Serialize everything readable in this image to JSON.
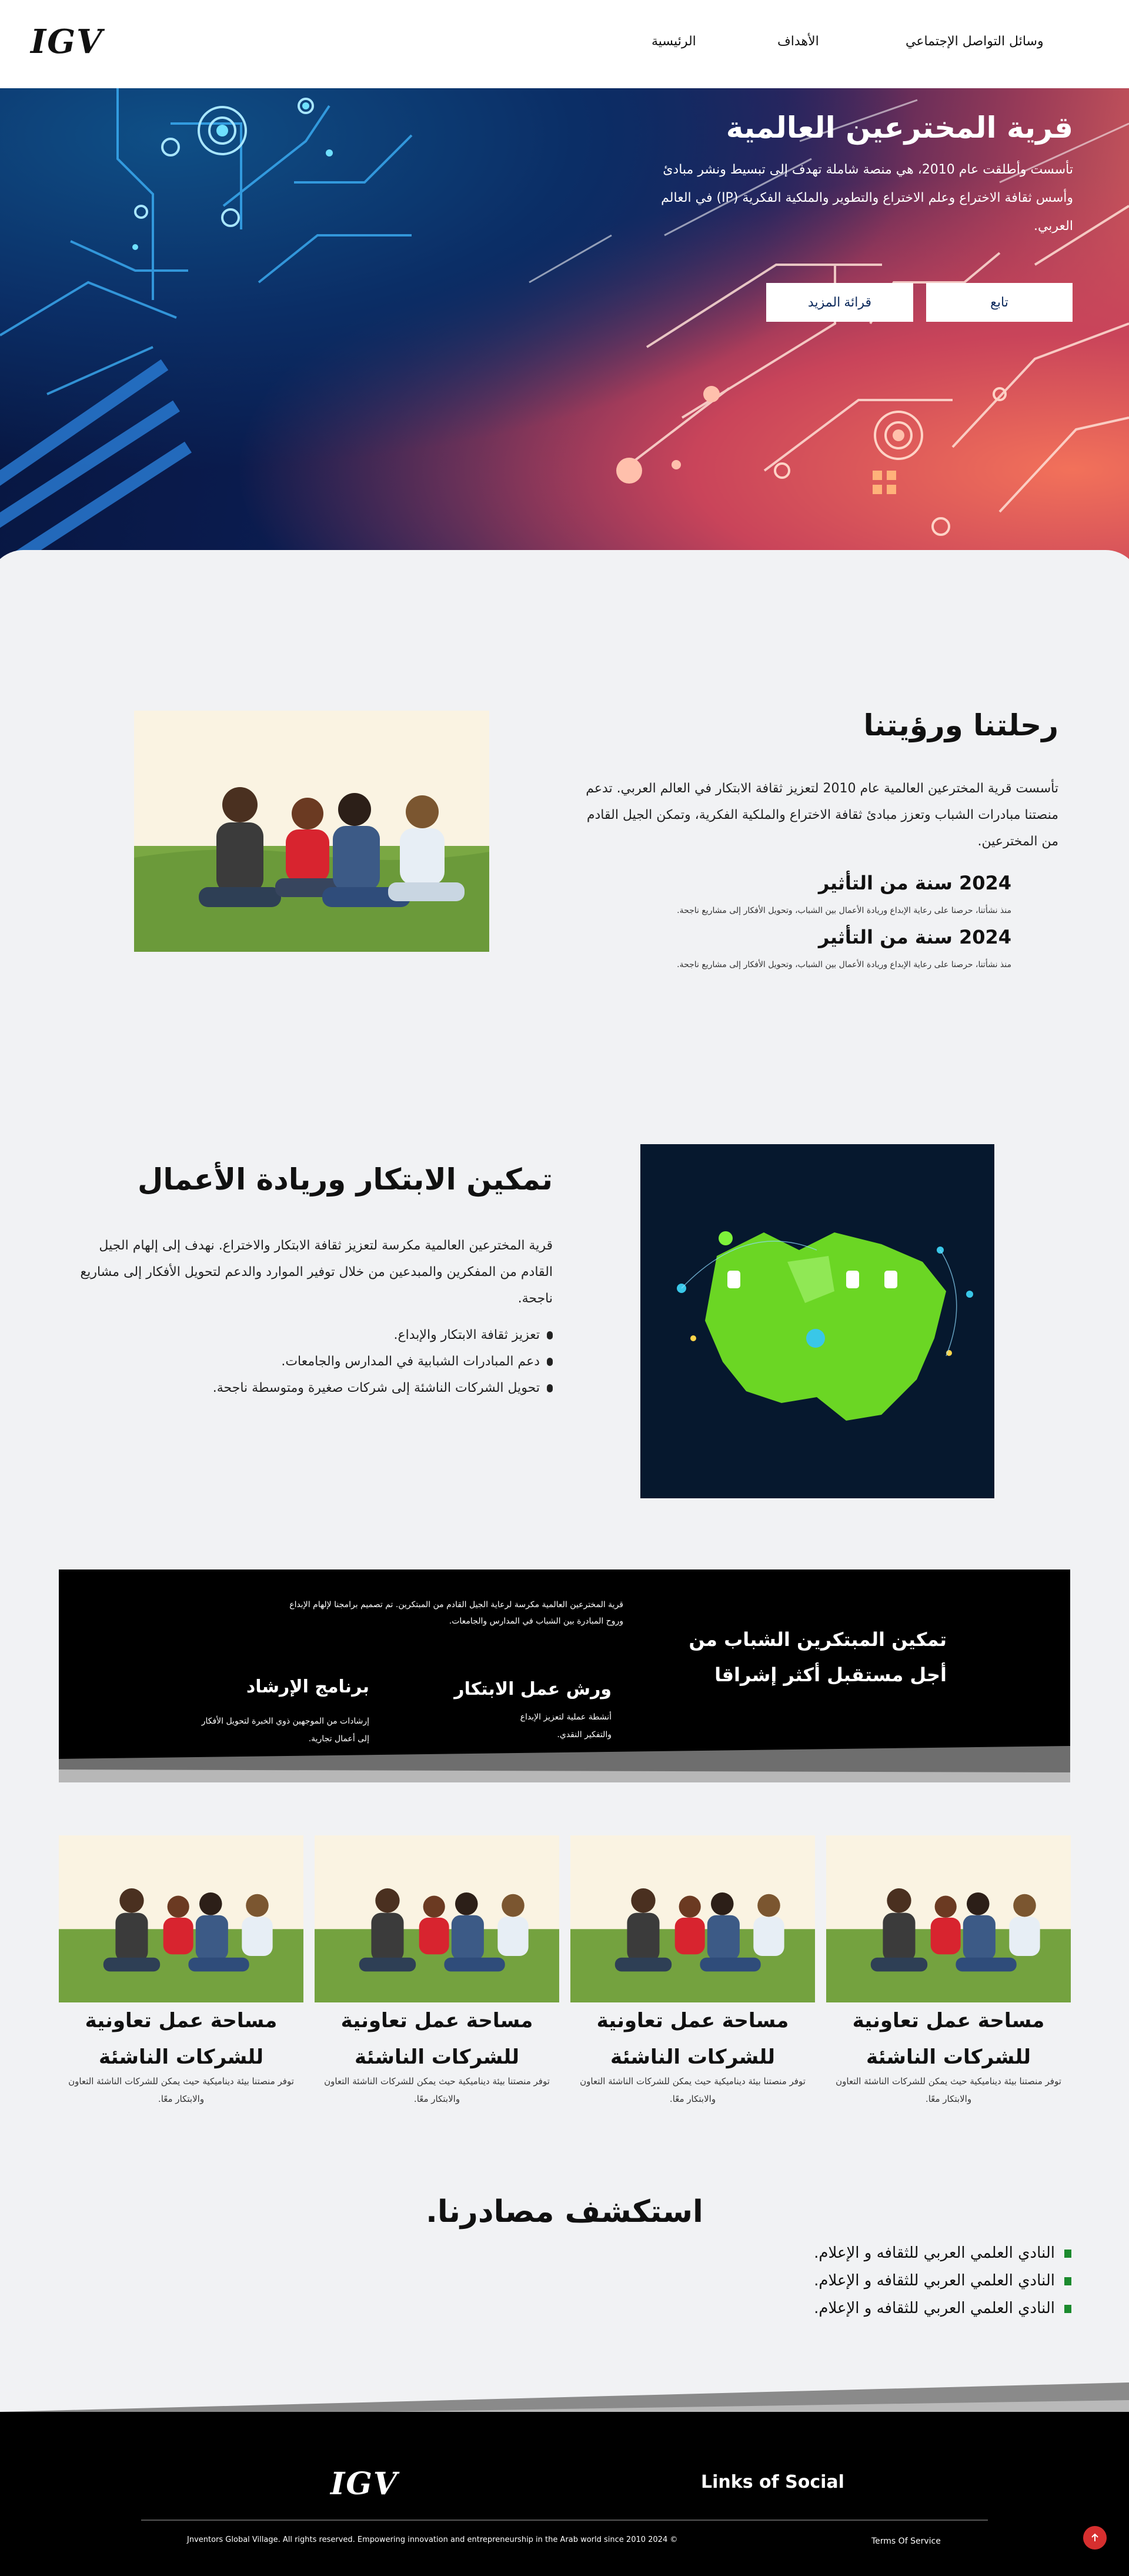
{
  "header": {
    "logo": "IGV",
    "nav": {
      "home": "الرئيسية",
      "goals": "الأهداف",
      "social": "وسائل التواصل الإجتماعي"
    }
  },
  "hero": {
    "title": "قرية المخترعين العالمية",
    "text": "تأسست وأطلقت عام 2010، هي منصة شاملة تهدف إلى تبسيط ونشر مبادئ وأسس ثقافة الاختراع وعلم الاختراع والتطوير والملكية الفكرية (IP) في العالم العربي.",
    "follow_label": "تابع",
    "read_more_label": "قرائة المزيد"
  },
  "journey": {
    "title": "رحلتنا ورؤيتنا",
    "text": "تأسست قرية المخترعين العالمية عام 2010 لتعزيز ثقافة الابتكار في العالم العربي. تدعم منصتنا مبادرات الشباب وتعزز مبادئ ثقافة الاختراع والملكية الفكرية، وتمكن الجيل القادم من المخترعين.",
    "stats": [
      {
        "title": "2024 سنة من التأثير",
        "desc": "منذ نشأتنا، حرصنا على رعاية الإبداع وريادة الأعمال بين الشباب، وتحويل الأفكار إلى مشاريع ناجحة."
      },
      {
        "title": "2024 سنة من التأثير",
        "desc": "منذ نشأتنا، حرصنا على رعاية الإبداع وريادة الأعمال بين الشباب، وتحويل الأفكار إلى مشاريع ناجحة."
      }
    ]
  },
  "empower": {
    "title": "تمكين الابتكار وريادة الأعمال",
    "text": "قرية المخترعين العالمية مكرسة لتعزيز ثقافة الابتكار والاختراع. نهدف إلى إلهام الجيل القادم من المفكرين والمبدعين من خلال توفير الموارد والدعم لتحويل الأفكار إلى مشاريع ناجحة.",
    "bullets": [
      "تعزيز ثقافة الابتكار والإبداع.",
      "دعم المبادرات الشبابية في المدارس والجامعات.",
      "تحويل الشركات الناشئة إلى شركات صغيرة ومتوسطة ناجحة."
    ]
  },
  "band": {
    "headline_line1": "تمكين المبتكرين الشباب من",
    "headline_line2": "أجل مستقبل أكثر إشراقا",
    "intro_line1": "قرية المخترعين العالمية مكرسة لرعاية الجيل القادم من المبتكرين. تم تصميم برامجنا لإلهام الإبداع",
    "intro_line2": "وروح المبادرة بين الشباب في المدارس والجامعات.",
    "workshops": {
      "title": "ورش عمل الابتكار",
      "line1": "أنشطة عملية لتعزيز الإبداع",
      "line2": "والتفكير النقدي."
    },
    "mentor": {
      "title": "برنامج الإرشاد",
      "line1": "إرشادات من الموجهين ذوي الخبرة لتحويل الأفكار",
      "line2": "إلى أعمال تجارية."
    }
  },
  "cards": [
    {
      "title": "مساحة عمل تعاونية للشركات الناشئة",
      "desc": "توفر منصتنا بيئة ديناميكية حيث يمكن للشركات الناشئة التعاون والابتكار معًا."
    },
    {
      "title": "مساحة عمل تعاونية للشركات الناشئة",
      "desc": "توفر منصتنا بيئة ديناميكية حيث يمكن للشركات الناشئة التعاون والابتكار معًا."
    },
    {
      "title": "مساحة عمل تعاونية للشركات الناشئة",
      "desc": "توفر منصتنا بيئة ديناميكية حيث يمكن للشركات الناشئة التعاون والابتكار معًا."
    },
    {
      "title": "مساحة عمل تعاونية للشركات الناشئة",
      "desc": "توفر منصتنا بيئة ديناميكية حيث يمكن للشركات الناشئة التعاون والابتكار معًا."
    }
  ],
  "resources": {
    "title": "استكشف مصادرنا.",
    "items": [
      "النادي العلمي العربي للثقافه و الإعلام.",
      "النادي العلمي العربي للثقافه و الإعلام.",
      "النادي العلمي العربي للثقافه و الإعلام."
    ]
  },
  "footer": {
    "logo": "IGV",
    "links_title": "Links of Social",
    "copyright": "Jnventors Global Village. All rights reserved. Empowering innovation and entrepreneurship in the Arab world since 2010 2024 ©",
    "terms": "Terms Of Service"
  },
  "colors": {
    "hero_blue": "#0b2e66",
    "hero_red": "#d95f5b",
    "button_text": "#0d2a5c",
    "bullet_green": "#1b8a2d",
    "scroll_top": "#d62f2f"
  }
}
